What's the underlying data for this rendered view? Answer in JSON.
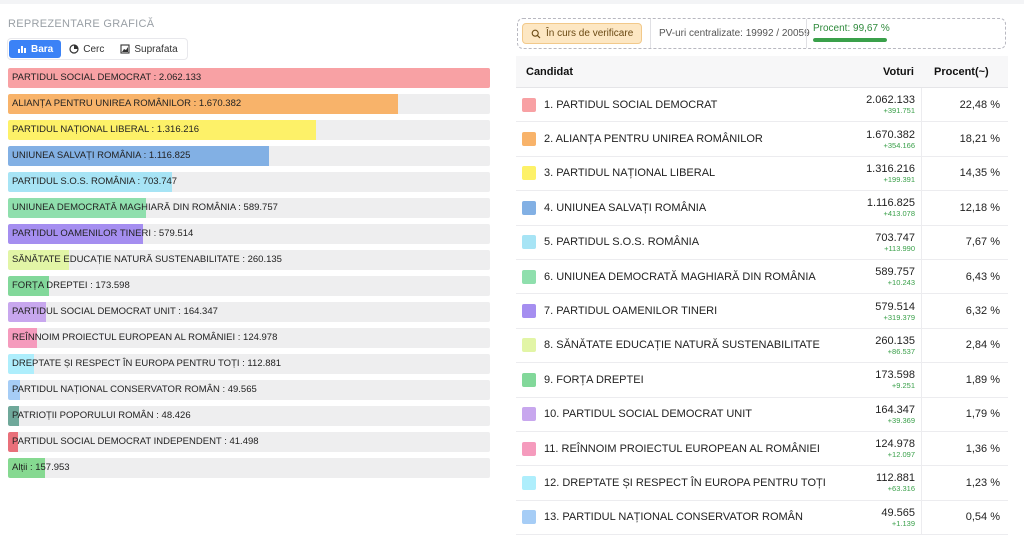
{
  "left": {
    "title": "REPREZENTARE GRAFICĂ",
    "tabs": [
      {
        "label": "Bara",
        "icon": "bar-chart-icon",
        "active": true
      },
      {
        "label": "Cerc",
        "icon": "pie-chart-icon",
        "active": false
      },
      {
        "label": "Suprafata",
        "icon": "area-chart-icon",
        "active": false
      }
    ]
  },
  "status": {
    "verif_label": "În curs de verificare",
    "pv_label": "PV-uri centralizate: 19992 / 20059",
    "pct_label": "Procent: 99,67 %",
    "pct_value": 99.67
  },
  "table_headers": {
    "candidat": "Candidat",
    "voturi": "Voturi",
    "procent": "Procent(~)"
  },
  "colors": {
    "psd": "#f8a1a4",
    "aur": "#f8b36a",
    "pnl": "#fdf168",
    "usr": "#82b0e4",
    "sos": "#a7e4f5",
    "udmr": "#8fdfad",
    "pot": "#a58ef0",
    "sens": "#e2f5a6",
    "fd": "#82d89a",
    "psdu": "#c8a7ee",
    "repers": "#f59bbd",
    "drept": "#aeeefc",
    "pncr": "#a6cdf6",
    "ppr": "#6fa89a",
    "psdi": "#e9707a",
    "altii": "#86d991"
  },
  "chart_data": {
    "type": "bar",
    "orientation": "horizontal",
    "bar_labels": [
      "PARTIDUL SOCIAL DEMOCRAT : 2.062.133",
      "ALIANȚA PENTRU UNIREA ROMÂNILOR : 1.670.382",
      "PARTIDUL NAȚIONAL LIBERAL : 1.316.216",
      "UNIUNEA SALVAȚI ROMÂNIA : 1.116.825",
      "PARTIDUL S.O.S. ROMÂNIA : 703.747",
      "UNIUNEA DEMOCRATĂ MAGHIARĂ DIN ROMÂNIA : 589.757",
      "PARTIDUL OAMENILOR TINERI : 579.514",
      "SĂNĂTATE EDUCAȚIE NATURĂ SUSTENABILITATE : 260.135",
      "FORȚA DREPTEI : 173.598",
      "PARTIDUL SOCIAL DEMOCRAT UNIT : 164.347",
      "REÎNNOIM PROIECTUL EUROPEAN AL ROMÂNIEI : 124.978",
      "DREPTATE ȘI RESPECT ÎN EUROPA PENTRU TOȚI : 112.881",
      "PARTIDUL NAȚIONAL CONSERVATOR ROMÂN : 49.565",
      "PATRIOȚII POPORULUI ROMÂN : 48.426",
      "PARTIDUL SOCIAL DEMOCRAT INDEPENDENT : 41.498",
      "Alții : 157.953"
    ],
    "values": [
      2062133,
      1670382,
      1316216,
      1116825,
      703747,
      589757,
      579514,
      260135,
      173598,
      164347,
      124978,
      112881,
      49565,
      48426,
      41498,
      157953
    ],
    "color_keys": [
      "psd",
      "aur",
      "pnl",
      "usr",
      "sos",
      "udmr",
      "pot",
      "sens",
      "fd",
      "psdu",
      "repers",
      "drept",
      "pncr",
      "ppr",
      "psdi",
      "altii"
    ],
    "xlim": [
      0,
      2062133
    ]
  },
  "table_rows": [
    {
      "name": "1. PARTIDUL SOCIAL DEMOCRAT",
      "votes": "2.062.133",
      "delta": "+391.751",
      "pct": "22,48 %",
      "color_key": "psd"
    },
    {
      "name": "2. ALIANȚA PENTRU UNIREA ROMÂNILOR",
      "votes": "1.670.382",
      "delta": "+354.166",
      "pct": "18,21 %",
      "color_key": "aur"
    },
    {
      "name": "3. PARTIDUL NAȚIONAL LIBERAL",
      "votes": "1.316.216",
      "delta": "+199.391",
      "pct": "14,35 %",
      "color_key": "pnl"
    },
    {
      "name": "4. UNIUNEA SALVAȚI ROMÂNIA",
      "votes": "1.116.825",
      "delta": "+413.078",
      "pct": "12,18 %",
      "color_key": "usr"
    },
    {
      "name": "5. PARTIDUL S.O.S. ROMÂNIA",
      "votes": "703.747",
      "delta": "+113.990",
      "pct": "7,67 %",
      "color_key": "sos"
    },
    {
      "name": "6. UNIUNEA DEMOCRATĂ MAGHIARĂ DIN ROMÂNIA",
      "votes": "589.757",
      "delta": "+10.243",
      "pct": "6,43 %",
      "color_key": "udmr"
    },
    {
      "name": "7. PARTIDUL OAMENILOR TINERI",
      "votes": "579.514",
      "delta": "+319.379",
      "pct": "6,32 %",
      "color_key": "pot"
    },
    {
      "name": "8. SĂNĂTATE EDUCAȚIE NATURĂ SUSTENABILITATE",
      "votes": "260.135",
      "delta": "+86.537",
      "pct": "2,84 %",
      "color_key": "sens"
    },
    {
      "name": "9. FORȚA DREPTEI",
      "votes": "173.598",
      "delta": "+9.251",
      "pct": "1,89 %",
      "color_key": "fd"
    },
    {
      "name": "10. PARTIDUL SOCIAL DEMOCRAT UNIT",
      "votes": "164.347",
      "delta": "+39.369",
      "pct": "1,79 %",
      "color_key": "psdu"
    },
    {
      "name": "11. REÎNNOIM PROIECTUL EUROPEAN AL ROMÂNIEI",
      "votes": "124.978",
      "delta": "+12.097",
      "pct": "1,36 %",
      "color_key": "repers"
    },
    {
      "name": "12. DREPTATE ȘI RESPECT ÎN EUROPA PENTRU TOȚI",
      "votes": "112.881",
      "delta": "+63.316",
      "pct": "1,23 %",
      "color_key": "drept"
    },
    {
      "name": "13. PARTIDUL NAȚIONAL CONSERVATOR ROMÂN",
      "votes": "49.565",
      "delta": "+1.139",
      "pct": "0,54 %",
      "color_key": "pncr"
    }
  ]
}
